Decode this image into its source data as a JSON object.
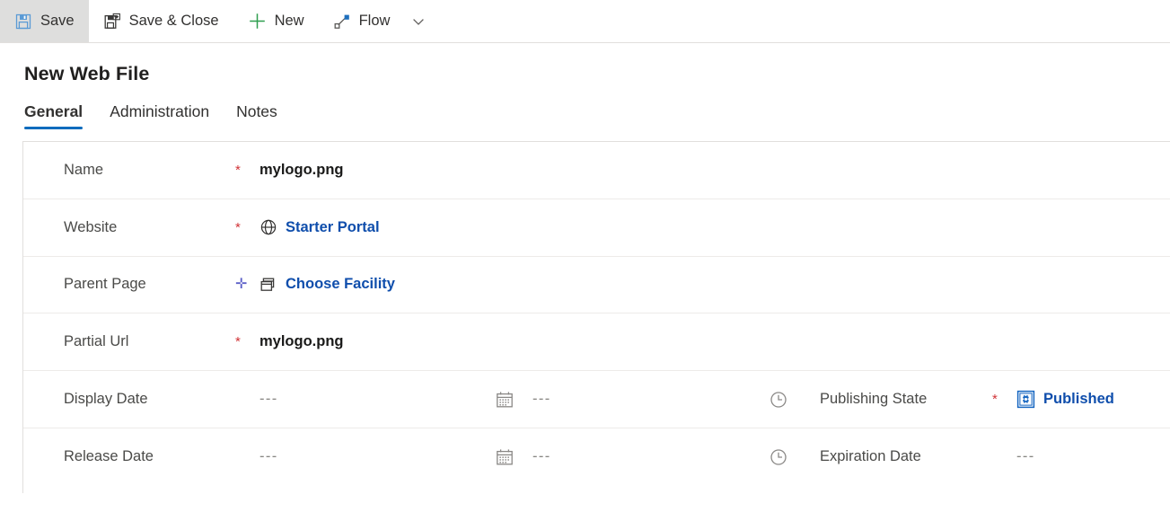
{
  "commandbar": {
    "buttons": [
      {
        "id": "save",
        "label": "Save",
        "icon": "save-icon",
        "active": true
      },
      {
        "id": "save-close",
        "label": "Save & Close",
        "icon": "save-close-icon",
        "active": false
      },
      {
        "id": "new",
        "label": "New",
        "icon": "plus-icon",
        "active": false
      },
      {
        "id": "flow",
        "label": "Flow",
        "icon": "flow-icon",
        "active": false
      }
    ],
    "overflow_icon": "chevron-down-icon"
  },
  "page": {
    "title": "New Web File"
  },
  "tabs": [
    {
      "id": "general",
      "label": "General",
      "selected": true
    },
    {
      "id": "administration",
      "label": "Administration",
      "selected": false
    },
    {
      "id": "notes",
      "label": "Notes",
      "selected": false
    }
  ],
  "form": {
    "rows": [
      {
        "type": "simple",
        "label": "Name",
        "requirement": "required",
        "value": "mylogo.png",
        "value_kind": "text",
        "icon": null
      },
      {
        "type": "simple",
        "label": "Website",
        "requirement": "required",
        "value": "Starter Portal",
        "value_kind": "link",
        "icon": "globe-icon"
      },
      {
        "type": "simple",
        "label": "Parent Page",
        "requirement": "recommended",
        "value": "Choose Facility",
        "value_kind": "link",
        "icon": "pages-icon"
      },
      {
        "type": "simple",
        "label": "Partial Url",
        "requirement": "required",
        "value": "mylogo.png",
        "value_kind": "text",
        "icon": null
      },
      {
        "type": "datetime",
        "label": "Display Date",
        "requirement": "none",
        "date_value": "---",
        "date_icon": "calendar-icon",
        "time_value": "---",
        "time_icon": "clock-icon",
        "second_label": "Publishing State",
        "second_requirement": "required",
        "second_value": "Published",
        "second_value_kind": "link",
        "second_icon": "publishing-state-icon"
      },
      {
        "type": "datetime",
        "label": "Release Date",
        "requirement": "none",
        "date_value": "---",
        "date_icon": "calendar-icon",
        "time_value": "---",
        "time_icon": "clock-icon",
        "second_label": "Expiration Date",
        "second_requirement": "none",
        "second_value": "---",
        "second_value_kind": "empty",
        "second_icon": null
      }
    ]
  },
  "colors": {
    "accent_blue": "#0f6cbd",
    "link_blue": "#0f4eac",
    "required_red": "#d13438",
    "recommended_blue": "#5b5fc7",
    "divider": "#edebe9",
    "active_button_bg": "#dededd"
  }
}
